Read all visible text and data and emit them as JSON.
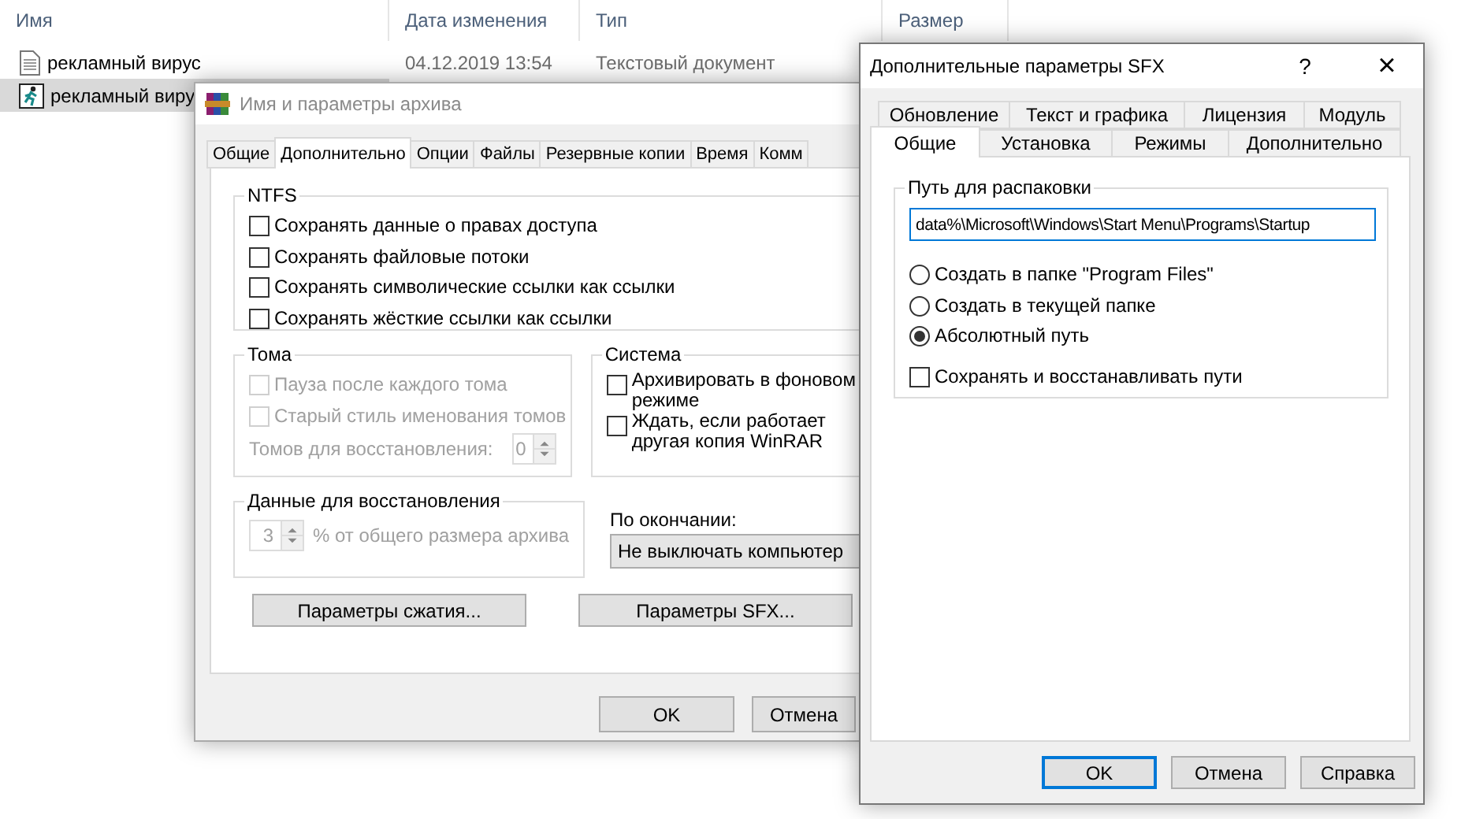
{
  "explorer": {
    "columns": [
      "Имя",
      "Дата изменения",
      "Тип",
      "Размер"
    ],
    "files": [
      {
        "name": "рекламный вирус",
        "date": "04.12.2019 13:54",
        "type": "Текстовый документ",
        "kind": "text",
        "selected": false
      },
      {
        "name": "рекламный виру",
        "kind": "exe",
        "selected": true
      }
    ]
  },
  "archive_dialog": {
    "title": "Имя и параметры архива",
    "active": false,
    "tabs": [
      {
        "label": "Общие",
        "selected": false
      },
      {
        "label": "Дополнительно",
        "selected": true
      },
      {
        "label": "Опции",
        "selected": false
      },
      {
        "label": "Файлы",
        "selected": false
      },
      {
        "label": "Резервные копии",
        "selected": false
      },
      {
        "label": "Время",
        "selected": false
      },
      {
        "label": "Комм",
        "selected": false
      }
    ],
    "ntfs": {
      "title": "NTFS",
      "options": [
        {
          "label": "Сохранять данные о правах доступа",
          "checked": false,
          "disabled": false
        },
        {
          "label": "Сохранять файловые потоки",
          "checked": false,
          "disabled": false
        },
        {
          "label": "Сохранять символические ссылки как ссылки",
          "checked": false,
          "disabled": false
        },
        {
          "label": "Сохранять жёсткие ссылки как ссылки",
          "checked": false,
          "disabled": false
        }
      ]
    },
    "volumes": {
      "title": "Тома",
      "options": [
        {
          "label": "Пауза после каждого тома",
          "checked": false,
          "disabled": true
        },
        {
          "label": "Старый стиль именования томов",
          "checked": false,
          "disabled": true
        }
      ],
      "recovery_label": "Томов для восстановления:",
      "recovery_value": "0",
      "disabled": true
    },
    "system": {
      "title": "Система",
      "options": [
        {
          "label": "Архивировать в фоновом режиме",
          "checked": false,
          "disabled": false
        },
        {
          "label": "Ждать, если работает другая копия WinRAR",
          "checked": false,
          "disabled": false
        }
      ]
    },
    "recovery": {
      "title": "Данные для восстановления",
      "value": "3",
      "unit": "% от общего размера архива",
      "disabled": true
    },
    "on_finish": {
      "label": "По окончании:",
      "value": "Не выключать компьютер"
    },
    "option_buttons": [
      "Параметры сжатия...",
      "Параметры SFX..."
    ],
    "buttons": [
      {
        "label": "OK",
        "default": false
      },
      {
        "label": "Отмена",
        "default": false
      }
    ]
  },
  "sfx_dialog": {
    "title": "Дополнительные параметры SFX",
    "help": "?",
    "close": "×",
    "tab_rows": [
      [
        {
          "label": "Обновление",
          "selected": false
        },
        {
          "label": "Текст и графика",
          "selected": false
        },
        {
          "label": "Лицензия",
          "selected": false
        },
        {
          "label": "Модуль",
          "selected": false
        }
      ],
      [
        {
          "label": "Общие",
          "selected": true
        },
        {
          "label": "Установка",
          "selected": false
        },
        {
          "label": "Режимы",
          "selected": false
        },
        {
          "label": "Дополнительно",
          "selected": false
        }
      ]
    ],
    "path_group": {
      "title": "Путь для распаковки",
      "value": "data%\\Microsoft\\Windows\\Start Menu\\Programs\\Startup",
      "radios": [
        {
          "label": "Создать в папке \"Program Files\"",
          "selected": false
        },
        {
          "label": "Создать в текущей папке",
          "selected": false
        },
        {
          "label": "Абсолютный путь",
          "selected": true
        }
      ],
      "checkbox": {
        "label": "Сохранять и восстанавливать пути",
        "checked": false
      }
    },
    "buttons": [
      {
        "label": "OK",
        "default": true
      },
      {
        "label": "Отмена",
        "default": false
      },
      {
        "label": "Справка",
        "default": false
      }
    ]
  }
}
